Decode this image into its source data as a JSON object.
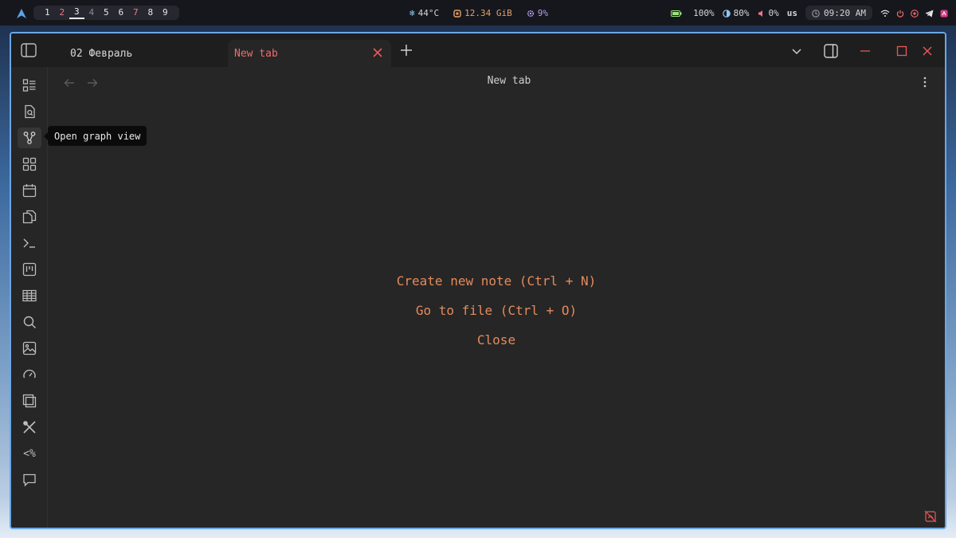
{
  "topbar": {
    "workspaces": [
      {
        "label": "1",
        "state": "occupied"
      },
      {
        "label": "2",
        "state": "urgent"
      },
      {
        "label": "3",
        "state": "active"
      },
      {
        "label": "4",
        "state": "empty"
      },
      {
        "label": "5",
        "state": "occupied"
      },
      {
        "label": "6",
        "state": "occupied"
      },
      {
        "label": "7",
        "state": "urgent"
      },
      {
        "label": "8",
        "state": "occupied"
      },
      {
        "label": "9",
        "state": "occupied"
      }
    ],
    "temperature": "44°C",
    "memory": "12.34 GiB",
    "cpu": "9%",
    "battery": "100%",
    "brightness": "80%",
    "volume": "0%",
    "keyboard_layout": "us",
    "clock": "09:20 AM",
    "colors": {
      "bar_bg": "#16171d",
      "pill_bg": "#26272f",
      "urgent": "#ef7a8a",
      "arch_blue": "#5aa3e8",
      "cpu_purple": "#b79cf0",
      "mem_orange": "#e2a36b",
      "battery_green": "#9be37e",
      "volume_red": "#ef7a8a"
    }
  },
  "window": {
    "tabs": [
      {
        "label": "02 Февраль",
        "active": false
      },
      {
        "label": "New tab",
        "active": true
      }
    ],
    "view_title": "New tab",
    "tooltip": "Open graph view",
    "ribbon_icons": [
      "file-explorer-icon",
      "search-in-file-icon",
      "graph-view-icon",
      "canvas-icon",
      "calendar-icon",
      "copy-icon",
      "terminal-icon",
      "kanban-icon",
      "table-icon",
      "search-icon",
      "image-icon",
      "gauge-icon",
      "layers-icon",
      "tools-icon",
      "template-icon",
      "chat-icon"
    ],
    "empty_state": {
      "create_note": "Create new note (Ctrl + N)",
      "go_to_file": "Go to file (Ctrl + O)",
      "close": "Close"
    },
    "colors": {
      "accent_border": "#6aa6e6",
      "active_tab_text": "#ef6b6b",
      "action_text": "#e58a5c",
      "close_red": "#e85a5a"
    }
  }
}
